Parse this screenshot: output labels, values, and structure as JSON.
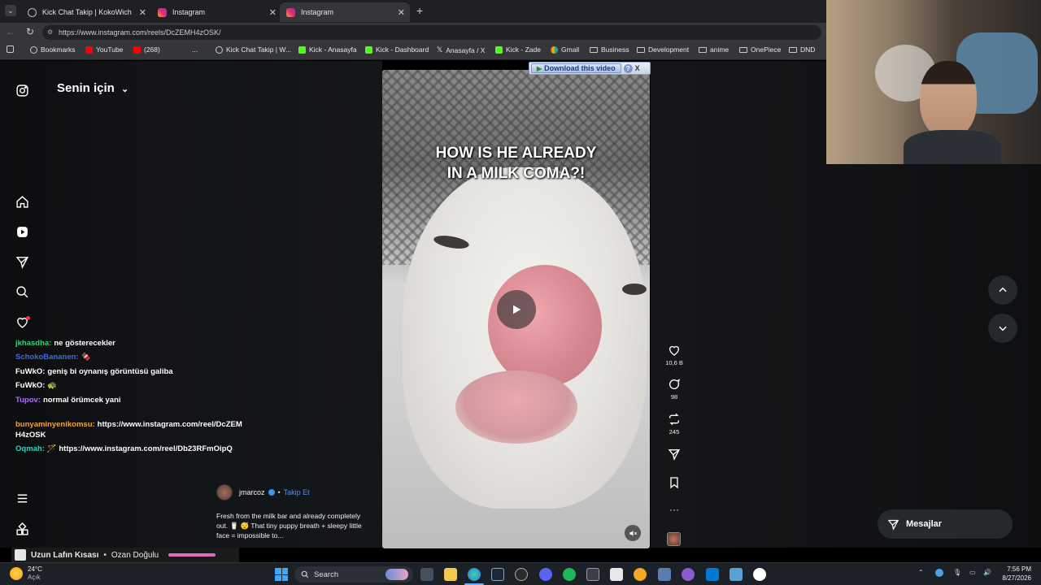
{
  "browser": {
    "tabs": [
      {
        "title": "Kick Chat Takip | KokoWich",
        "active": false
      },
      {
        "title": "Instagram",
        "active": false
      },
      {
        "title": "Instagram",
        "active": true
      }
    ],
    "url": "https://www.instagram.com/reels/DcZEMH4zOSK/",
    "bookmarks": [
      {
        "label": "Bookmarks",
        "icon": "globe-icon"
      },
      {
        "label": "YouTube",
        "icon": "youtube-icon"
      },
      {
        "label": "(268)",
        "icon": "youtube-icon"
      },
      {
        "label": "...",
        "icon": ""
      },
      {
        "label": "Kick Chat Takip | W...",
        "icon": "globe-icon"
      },
      {
        "label": "Kick - Anasayfa",
        "icon": "kick-icon"
      },
      {
        "label": "Kick - Dashboard",
        "icon": "kick-icon"
      },
      {
        "label": "Anasayfa / X",
        "icon": "x-icon"
      },
      {
        "label": "Kick - Zade",
        "icon": "kick-icon"
      },
      {
        "label": "Gmail",
        "icon": "google-icon"
      },
      {
        "label": "Business",
        "icon": "folder-icon"
      },
      {
        "label": "Development",
        "icon": "folder-icon"
      },
      {
        "label": "anime",
        "icon": "folder-icon"
      },
      {
        "label": "OnePiece",
        "icon": "folder-icon"
      },
      {
        "label": "DND",
        "icon": "folder-icon"
      }
    ]
  },
  "download_bar": {
    "label": "Download this video",
    "help": "?",
    "close": "X"
  },
  "sidebar": {
    "feed_title": "Senin için",
    "icons": [
      "instagram-icon",
      "home-icon",
      "reels-icon",
      "send-icon",
      "search-icon",
      "heart-icon",
      "menu-icon",
      "apps-icon"
    ]
  },
  "chat": [
    {
      "user": "jkhasdha:",
      "msg": "ne gösterecekler",
      "color": "#33d17a"
    },
    {
      "user": "SchokoBananen:",
      "msg": "🍫",
      "color": "#3a6fd8"
    },
    {
      "user": "FuWkO:",
      "msg": "geniş bi oynanış görüntüsü galiba",
      "color": "#ffffff"
    },
    {
      "user": "FuWkO:",
      "msg": "🐢",
      "color": "#ffffff"
    },
    {
      "user": "Tupov:",
      "msg": "normal örümcek yani",
      "color": "#b36bff"
    },
    {
      "user": "bunyaminyenikomsu:",
      "msg": "https://www.instagram.com/reel/DcZEMH4zOSK",
      "color": "#f5a53a"
    },
    {
      "user": "Oqmah:",
      "msg": "🪄 https://www.instagram.com/reel/Db23RFmOipQ",
      "color": "#33d1c4"
    }
  ],
  "video": {
    "overlay_line1": "HOW IS HE ALREADY",
    "overlay_line2": "IN A MILK COMA?!",
    "state": "paused"
  },
  "actions": {
    "likes": "10,6 B",
    "comments": "98",
    "reposts": "245"
  },
  "post": {
    "author": "jmarcoz",
    "follow_label": "Takip Et",
    "caption": "Fresh from the milk bar and already completely out. 🥛 😴 That tiny puppy breath + sleepy little face = impossible to..."
  },
  "messages_label": "Mesajlar",
  "now_playing": {
    "title": "Uzun Lafın Kısası",
    "artist": "Ozan Doğulu",
    "progress": 0.85
  },
  "taskbar": {
    "weather_temp": "24°C",
    "weather_desc": "Açık",
    "search_label": "Search",
    "time": "7:56 PM",
    "date": "8/27/2026"
  }
}
